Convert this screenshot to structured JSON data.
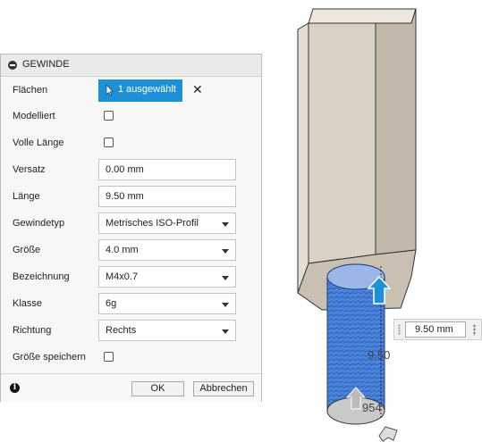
{
  "dialog": {
    "title": "GEWINDE",
    "rows": {
      "flaechen": {
        "label": "Flächen",
        "button": "1 ausgewählt"
      },
      "modelliert": {
        "label": "Modelliert",
        "checked": false
      },
      "volle_laenge": {
        "label": "Volle Länge",
        "checked": false
      },
      "versatz": {
        "label": "Versatz",
        "value": "0.00 mm"
      },
      "laenge": {
        "label": "Länge",
        "value": "9.50 mm"
      },
      "gewindetyp": {
        "label": "Gewindetyp",
        "value": "Metrisches ISO-Profil"
      },
      "groesse": {
        "label": "Größe",
        "value": "4.0 mm"
      },
      "bezeichnung": {
        "label": "Bezeichnung",
        "value": "M4x0.7"
      },
      "klasse": {
        "label": "Klasse",
        "value": "6g"
      },
      "richtung": {
        "label": "Richtung",
        "value": "Rechts"
      },
      "groesse_speichern": {
        "label": "Größe speichern",
        "checked": false
      }
    },
    "ok_label": "OK",
    "cancel_label": "Abbrechen"
  },
  "viewport": {
    "length_input": "9.50 mm",
    "dimension_label": "9.50",
    "diameter_label": "954",
    "colors": {
      "hex_body": "#d7d0c4",
      "thread": "#3f7ad6",
      "arrow": "#1e90d8"
    }
  },
  "icons": [
    "collapse-icon",
    "cursor-icon",
    "clear-icon",
    "caret-down-icon",
    "info-icon",
    "grip-icon",
    "menu-dots-icon",
    "drag-arrow-icon"
  ]
}
